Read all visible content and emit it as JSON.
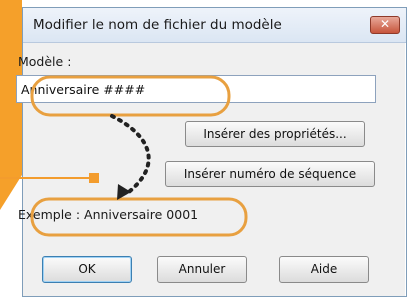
{
  "dialog": {
    "title": "Modifier le nom de fichier du modèle",
    "close_label": "✕",
    "template_label": "Modèle :",
    "template_value": "Anniversaire ####",
    "insert_properties_label": "Insérer des propriétés...",
    "insert_sequence_label": "Insérer numéro de séquence",
    "example_text": "Exemple :  Anniversaire 0001",
    "ok_label": "OK",
    "cancel_label": "Annuler",
    "help_label": "Aide"
  },
  "colors": {
    "accent_orange": "#f39c2d",
    "highlight_orange": "#e8a040"
  }
}
